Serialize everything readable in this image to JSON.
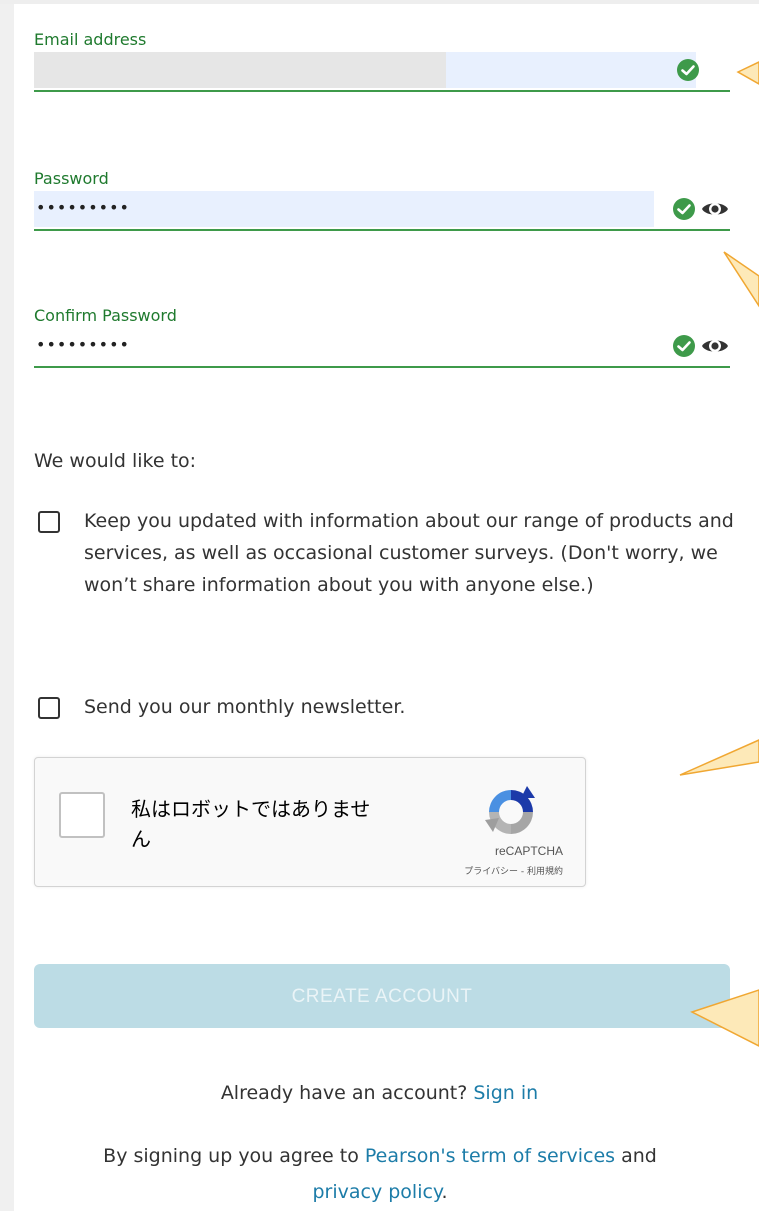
{
  "form": {
    "email": {
      "label": "Email address"
    },
    "password": {
      "label": "Password",
      "value": "•••••••••"
    },
    "confirm_password": {
      "label": "Confirm Password",
      "value": "•••••••••"
    }
  },
  "preferences": {
    "intro": "We would like to:",
    "options": [
      {
        "label": "Keep you updated with information about our range of products and services, as well as occasional customer surveys. (Don't worry, we won’t share information about you with anyone else.)",
        "checked": false
      },
      {
        "label": "Send you our monthly newsletter.",
        "checked": false
      }
    ]
  },
  "captcha": {
    "label": "私はロボットではありません",
    "brand": "reCAPTCHA",
    "links": "プライバシー - 利用規約"
  },
  "actions": {
    "create_account": "CREATE ACCOUNT"
  },
  "footer": {
    "signin_prompt": "Already have an account?",
    "signin_link": "Sign in",
    "terms_prefix": "By signing up you agree to",
    "terms_link": "Pearson's term of services",
    "terms_and": "and",
    "privacy_link": "privacy policy",
    "terms_suffix": "."
  },
  "colors": {
    "valid_green": "#3e9a4a",
    "label_green": "#1f7a2e",
    "autofill_blue": "#e8f0fe",
    "button_disabled": "#bcdce5",
    "link_blue": "#1c7ca8",
    "callout_orange": "#f0a732",
    "callout_fill": "#fde9b8"
  },
  "icons": [
    "check-circle-icon",
    "eye-icon",
    "recaptcha-logo-icon"
  ]
}
